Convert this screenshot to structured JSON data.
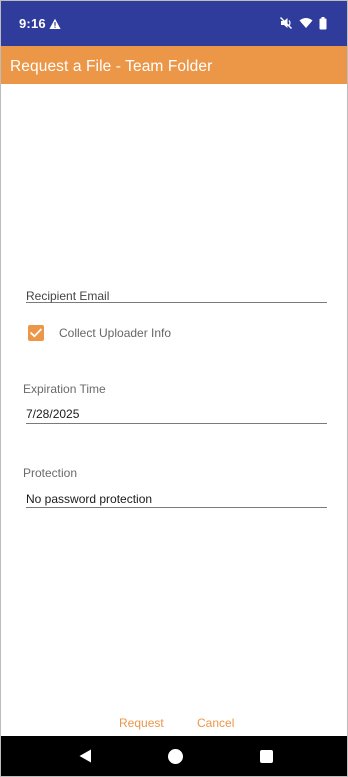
{
  "status_bar": {
    "time": "9:16",
    "icons": [
      "warning-icon",
      "mute-icon",
      "wifi-icon",
      "battery-icon"
    ]
  },
  "app_bar": {
    "title": "Request a File - Team Folder"
  },
  "form": {
    "recipient_email": {
      "placeholder": "Recipient Email",
      "value": ""
    },
    "collect_uploader_info": {
      "label": "Collect Uploader Info",
      "checked": true
    },
    "expiration_time": {
      "label": "Expiration Time",
      "value": "7/28/2025"
    },
    "protection": {
      "label": "Protection",
      "value": "No password protection"
    }
  },
  "actions": {
    "request_label": "Request",
    "cancel_label": "Cancel"
  },
  "colors": {
    "status_bar": "#2f3c9b",
    "accent": "#ec9648",
    "nav_bar": "#000000"
  }
}
